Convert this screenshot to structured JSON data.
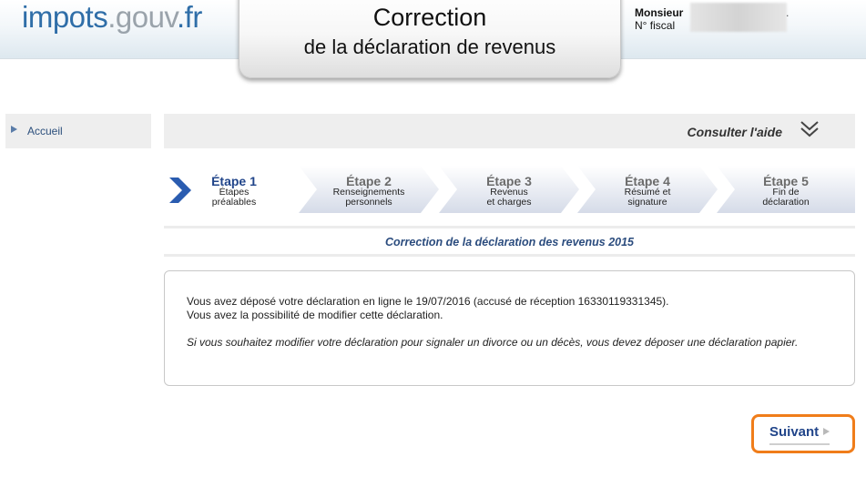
{
  "header": {
    "logo": {
      "part1": "impots",
      "part2": ".gouv",
      "part3": ".fr"
    },
    "title_line1": "Correction",
    "title_line2": "de la déclaration de revenus",
    "user_line1": "Monsieur",
    "user_line2": "N° fiscal",
    "user_suffix": "."
  },
  "sidebar": {
    "items": [
      {
        "label": "Accueil"
      }
    ]
  },
  "help": {
    "label": "Consulter l'aide",
    "icon": "double-chevron-down-icon"
  },
  "steps": [
    {
      "title": "Étape 1",
      "line1": "Étapes",
      "line2": "préalables",
      "active": true
    },
    {
      "title": "Étape 2",
      "line1": "Renseignements",
      "line2": "personnels",
      "active": false
    },
    {
      "title": "Étape 3",
      "line1": "Revenus",
      "line2": "et charges",
      "active": false
    },
    {
      "title": "Étape 4",
      "line1": "Résumé et",
      "line2": "signature",
      "active": false
    },
    {
      "title": "Étape 5",
      "line1": "Fin de",
      "line2": "déclaration",
      "active": false
    }
  ],
  "section_title": "Correction de la déclaration des revenus 2015",
  "info": {
    "line1": "Vous avez déposé votre déclaration en ligne le 19/07/2016 (accusé de réception 16330119331345).",
    "line2": "Vous avez la possibilité de modifier cette déclaration.",
    "line3": "Si vous souhaitez modifier votre déclaration pour signaler un divorce ou un décès, vous devez déposer une déclaration papier."
  },
  "next_button": {
    "label": "Suivant"
  },
  "colors": {
    "accent": "#21458a",
    "logo_blue": "#2f6ea8",
    "highlight_orange": "#f07d1a"
  }
}
